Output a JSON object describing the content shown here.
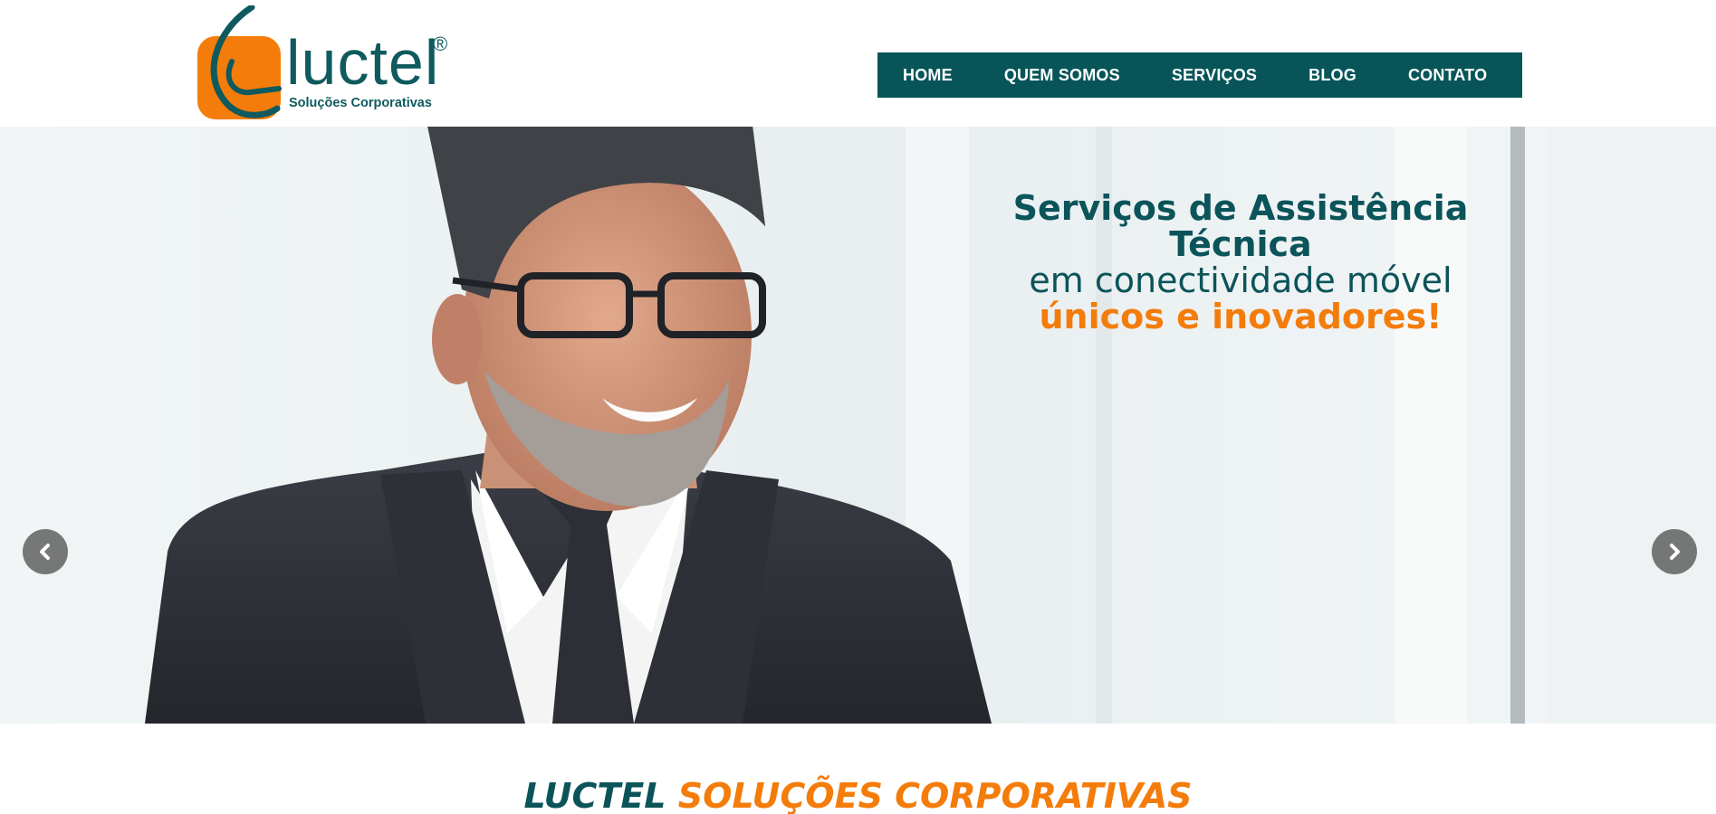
{
  "brand": {
    "name": "luctel",
    "registered": "®",
    "tagline": "Soluções Corporativas",
    "colors": {
      "teal": "#0b5459",
      "orange": "#f47c0a"
    }
  },
  "nav": {
    "items": [
      {
        "label": "HOME"
      },
      {
        "label": "QUEM SOMOS"
      },
      {
        "label": "SERVIÇOS"
      },
      {
        "label": "BLOG"
      },
      {
        "label": "CONTATO"
      }
    ]
  },
  "hero": {
    "line1": "Serviços de Assistência Técnica",
    "line2": "em conectividade móvel",
    "line3": "únicos e inovadores!",
    "prev_icon": "chevron-left-icon",
    "next_icon": "chevron-right-icon"
  },
  "section": {
    "title_part1": "LUCTEL",
    "title_part2": "SOLUÇÕES CORPORATIVAS"
  }
}
